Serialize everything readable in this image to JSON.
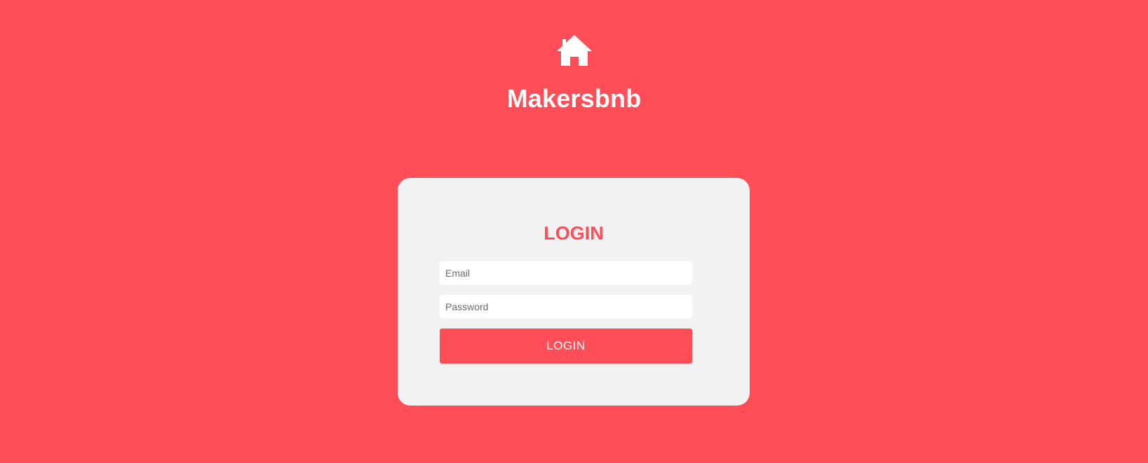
{
  "brand": {
    "title": "Makersbnb",
    "logo_icon": "home-icon"
  },
  "login_card": {
    "title": "LOGIN",
    "email": {
      "placeholder": "Email",
      "value": ""
    },
    "password": {
      "placeholder": "Password",
      "value": ""
    },
    "submit_label": "LOGIN"
  },
  "colors": {
    "background": "#FF4E57",
    "card_background": "#F2F2F2",
    "accent": "#FF4E57",
    "text_on_accent": "#FFFFFF"
  }
}
